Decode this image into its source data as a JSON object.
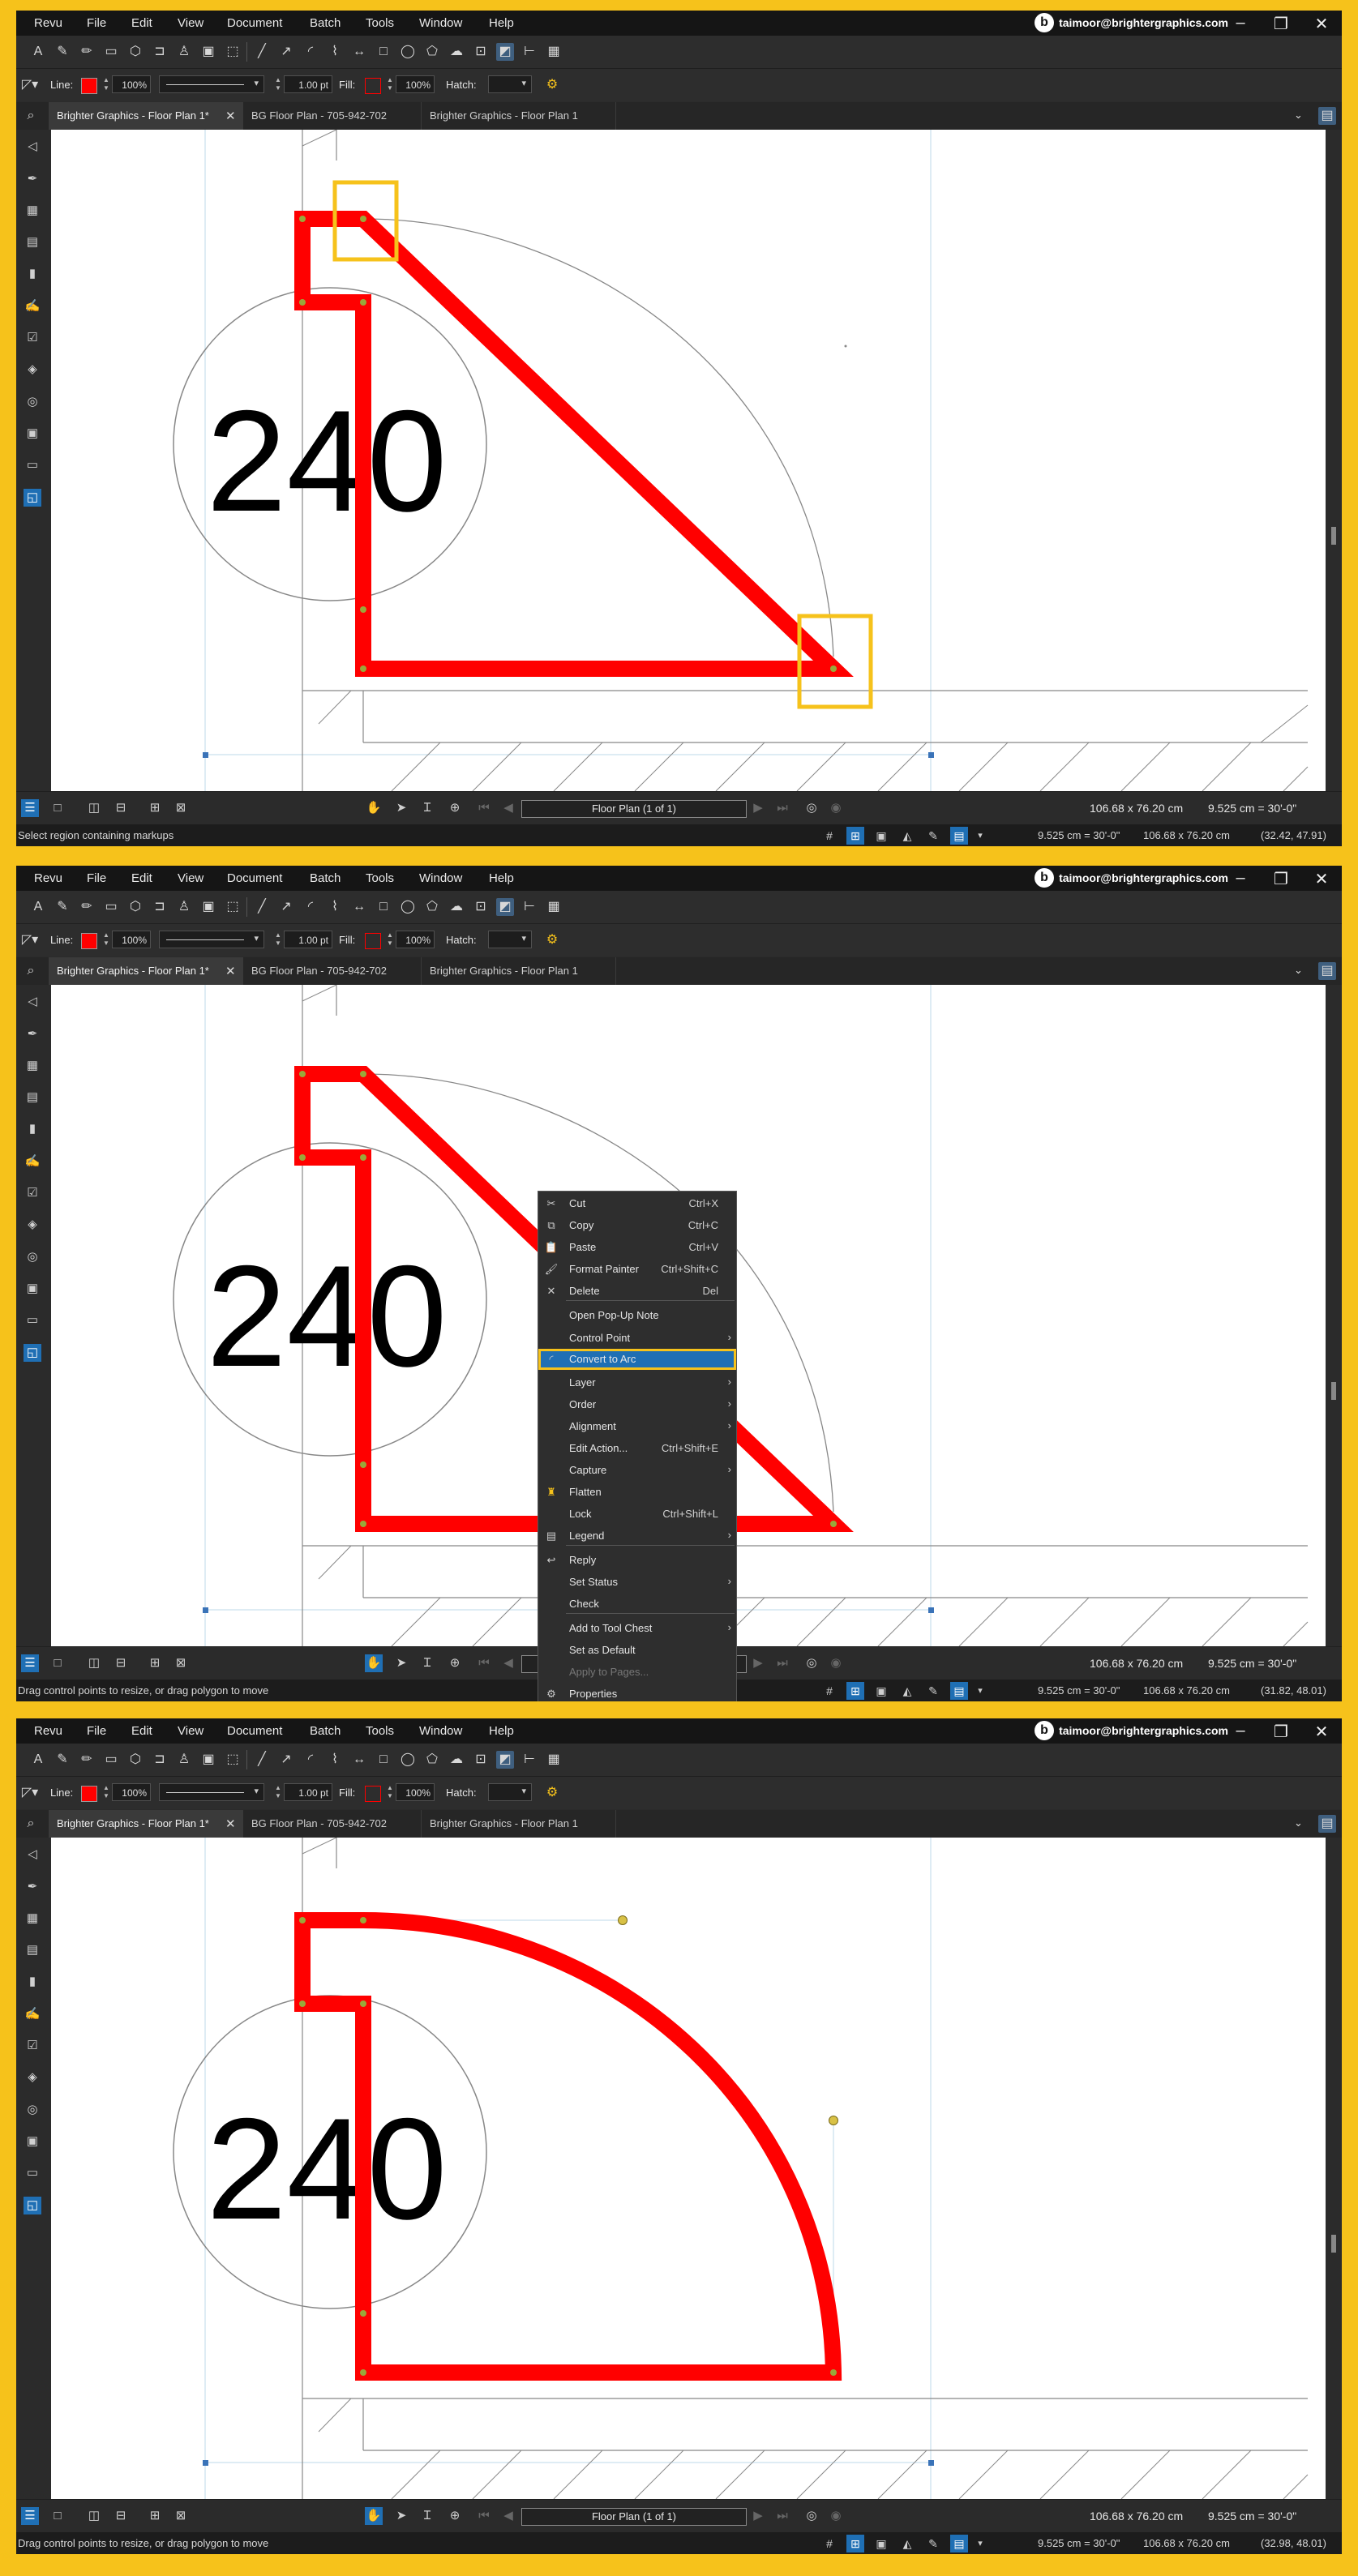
{
  "app": {
    "menus": [
      "Revu",
      "File",
      "Edit",
      "View",
      "Document",
      "Batch",
      "Tools",
      "Window",
      "Help"
    ],
    "user_email": "taimoor@brightergraphics.com"
  },
  "toolbar2": {
    "line_label": "Line:",
    "line_opacity": "100%",
    "line_width": "1.00 pt",
    "fill_label": "Fill:",
    "fill_opacity": "100%",
    "hatch_label": "Hatch:"
  },
  "tabs": [
    {
      "label": "Brighter Graphics - Floor Plan 1*"
    },
    {
      "label": "BG Floor Plan - 705-942-702"
    },
    {
      "label": "Brighter Graphics - Floor Plan 1"
    }
  ],
  "drawing": {
    "room_number": "240"
  },
  "navigation": {
    "page_label": "Floor Plan (1 of 1)"
  },
  "measurements": {
    "page_size": "106.68 x 76.20 cm",
    "scale": "9.525 cm = 30'-0\""
  },
  "panels": [
    {
      "status": "Select region containing markups",
      "cursor": "(32.42, 47.91)"
    },
    {
      "status": "Drag control points to resize, or drag polygon to move",
      "cursor": "(31.82, 48.01)"
    },
    {
      "status": "Drag control points to resize, or drag polygon to move",
      "cursor": "(32.98, 48.01)"
    }
  ],
  "context_menu": {
    "items": [
      {
        "label": "Cut",
        "shortcut": "Ctrl+X",
        "icon": "scissors-icon"
      },
      {
        "label": "Copy",
        "shortcut": "Ctrl+C",
        "icon": "copy-icon"
      },
      {
        "label": "Paste",
        "shortcut": "Ctrl+V",
        "icon": "paste-icon"
      },
      {
        "label": "Format Painter",
        "shortcut": "Ctrl+Shift+C",
        "icon": "brush-icon"
      },
      {
        "label": "Delete",
        "shortcut": "Del",
        "icon": "delete-icon"
      },
      {
        "label": "Open Pop-Up Note"
      },
      {
        "label": "Control Point",
        "submenu": true
      },
      {
        "label": "Convert to Arc",
        "icon": "arc-icon",
        "highlighted": true
      },
      {
        "label": "Layer",
        "submenu": true
      },
      {
        "label": "Order",
        "submenu": true
      },
      {
        "label": "Alignment",
        "submenu": true
      },
      {
        "label": "Edit Action...",
        "shortcut": "Ctrl+Shift+E"
      },
      {
        "label": "Capture",
        "submenu": true
      },
      {
        "label": "Flatten",
        "icon": "flatten-icon"
      },
      {
        "label": "Lock",
        "shortcut": "Ctrl+Shift+L"
      },
      {
        "label": "Legend",
        "submenu": true,
        "icon": "legend-icon"
      },
      {
        "label": "Reply",
        "icon": "reply-icon"
      },
      {
        "label": "Set Status",
        "submenu": true
      },
      {
        "label": "Check"
      },
      {
        "label": "Add to Tool Chest",
        "submenu": true
      },
      {
        "label": "Set as Default"
      },
      {
        "label": "Apply to Pages...",
        "disabled": true
      },
      {
        "label": "Properties",
        "icon": "gear-icon"
      }
    ]
  },
  "colors": {
    "frame": "#f6c21b",
    "markup_red": "#ff0000",
    "accent_blue": "#1f6fb4",
    "highlight_box": "#f6c21b"
  }
}
